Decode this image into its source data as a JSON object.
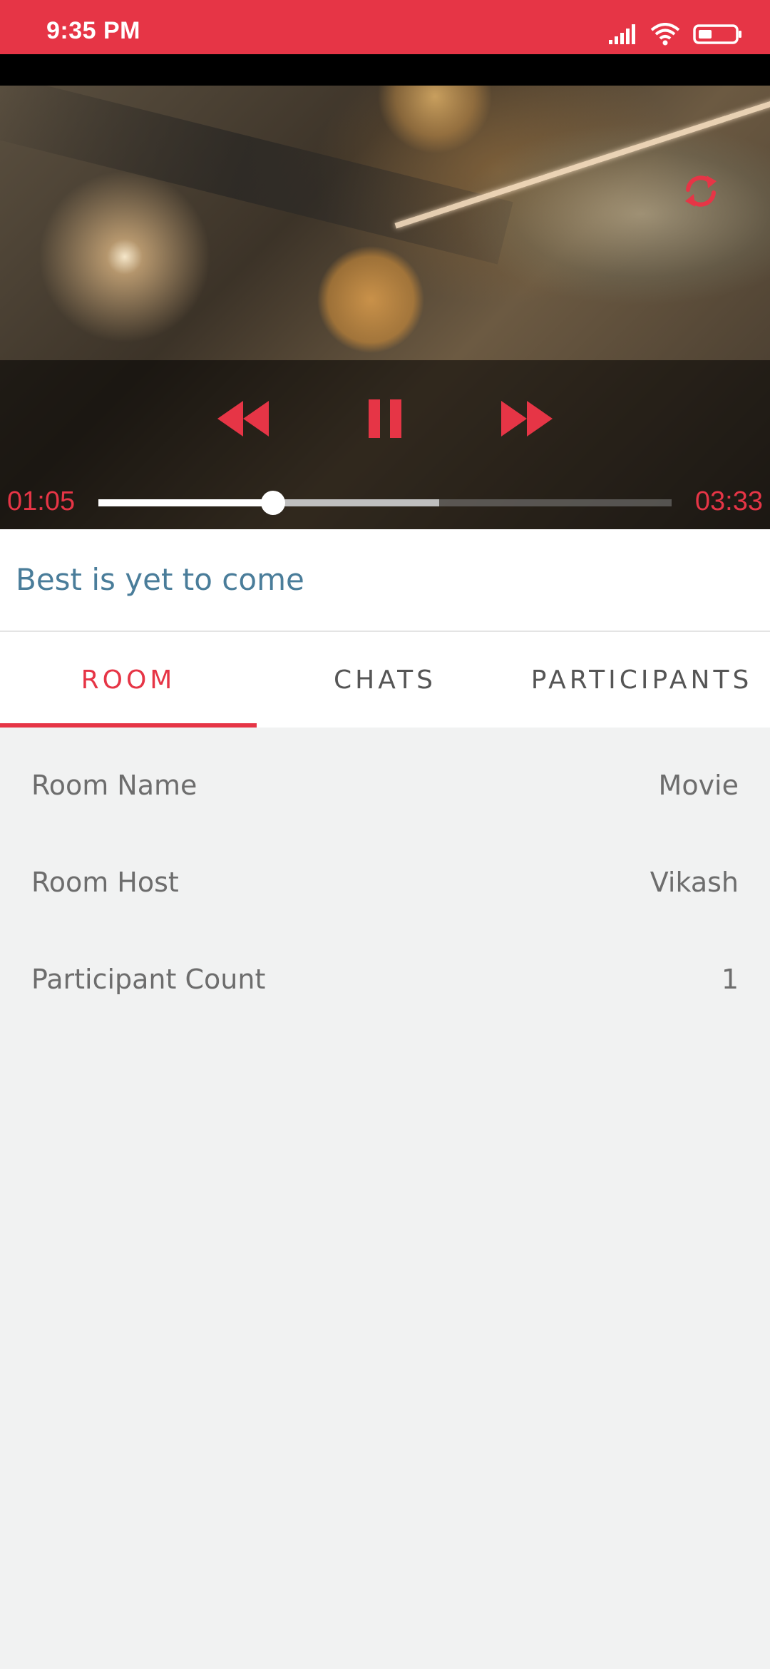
{
  "status_bar": {
    "time": "9:35 PM",
    "icons": [
      "signal-icon",
      "wifi-icon",
      "battery-icon"
    ],
    "color": "#e63546"
  },
  "player": {
    "sync_icon": "sync-icon",
    "controls": [
      "rewind-icon",
      "pause-icon",
      "fast-forward-icon"
    ],
    "elapsed": "01:05",
    "duration": "03:33",
    "progress_fraction": 0.305,
    "buffered_fraction": 0.595,
    "accent_color": "#e63546"
  },
  "video": {
    "title": "Best is yet to come"
  },
  "tabs": [
    {
      "label": "ROOM",
      "active": true
    },
    {
      "label": "CHATS",
      "active": false
    },
    {
      "label": "PARTICIPANTS",
      "active": false
    }
  ],
  "room_info": [
    {
      "label": "Room Name",
      "value": "Movie"
    },
    {
      "label": "Room Host",
      "value": "Vikash"
    },
    {
      "label": "Participant Count",
      "value": "1"
    }
  ]
}
